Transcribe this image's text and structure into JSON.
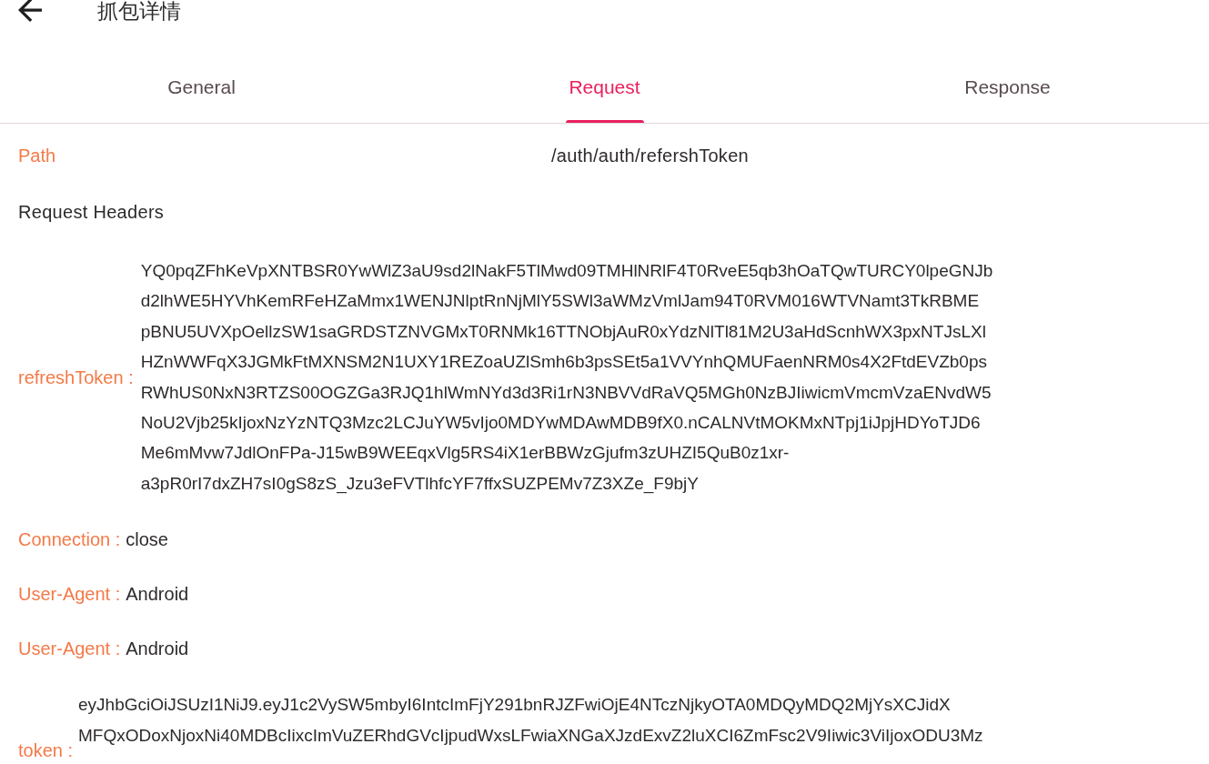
{
  "app_bar": {
    "title": "抓包详情"
  },
  "tabs": [
    {
      "label": "General",
      "selected": false
    },
    {
      "label": "Request",
      "selected": true
    },
    {
      "label": "Response",
      "selected": false
    }
  ],
  "path": {
    "label": "Path",
    "value": "/auth/auth/refershToken"
  },
  "request_headers": {
    "title": "Request Headers",
    "headers": [
      {
        "kind": "block",
        "name": "refreshToken :",
        "lines": [
          "YQ0pqZFhKeVpXNTBSR0YwWlZ3aU9sd2lNakF5TlMwd09TMHlNRlF4T0RveE5qb3hOaTQwTURCY0lpeGNJb",
          "d2lhWE5HYVhKemRFeHZaMmx1WENJNlptRnNjMlY5SWl3aWMzVmlJam94T0RVM016WTVNamt3TkRBME",
          "pBNU5UVXpOellzSW1saGRDSTZNVGMxT0RNMk16TTNObjAuR0xYdzNlTl81M2U3aHdScnhWX3pxNTJsLXl",
          "HZnWWFqX3JGMkFtMXNSM2N1UXY1REZoaUZlSmh6b3psSEt5a1VVYnhQMUFaenNRM0s4X2FtdEVZb0ps",
          "RWhUS0NxN3RTZS00OGZGa3RJQ1hlWmNYd3d3Ri1rN3NBVVdRaVQ5MGh0NzBJIiwicmVmcmVzaENvdW5",
          "NoU2Vjb25kIjoxNzYzNTQ3Mzc2LCJuYW5vIjo0MDYwMDAwMDB9fX0.nCALNVtMOKMxNTpj1iJpjHDYoTJD6",
          "Me6mMvw7JdlOnFPa-J15wB9WEEqxVlg5RS4iX1erBBWzGjufm3zUHZI5QuB0z1xr-",
          "a3pR0rI7dxZH7sI0gS8zS_Jzu3eFVTlhfcYF7ffxSUZPEMv7Z3XZe_F9bjY"
        ]
      },
      {
        "kind": "inline",
        "name": "Connection :",
        "value": "close"
      },
      {
        "kind": "inline",
        "name": "User-Agent :",
        "value": "Android"
      },
      {
        "kind": "inline",
        "name": "User-Agent :",
        "value": "Android"
      },
      {
        "kind": "block",
        "name": "token :",
        "lines": [
          "eyJhbGciOiJSUzI1NiJ9.eyJ1c2VySW5mbyI6IntcImFjY291bnRJZFwiOjE4NTczNjkyOTA0MDQyMDQ2MjYsXCJidX",
          "MFQxODoxNjoxNi40MDBcIixcImVuZERhdGVcIjpudWxsLFwiaXNGaXJzdExvZ2luXCI6ZmFsc2V9Iiwic3ViIjoxODU3Mz"
        ]
      }
    ]
  }
}
